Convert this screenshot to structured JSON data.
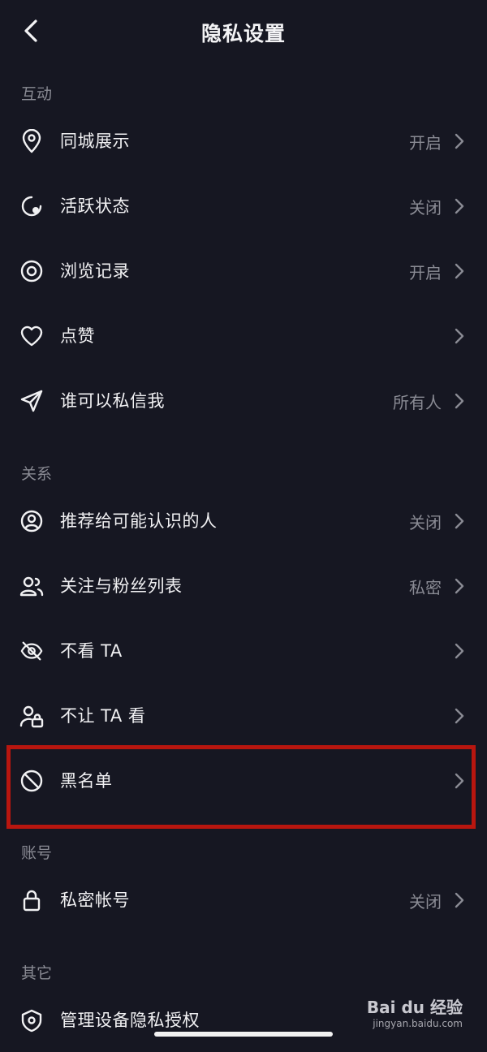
{
  "header": {
    "title": "隐私设置"
  },
  "sections": {
    "interaction": "互动",
    "relations": "关系",
    "account": "账号",
    "other": "其它"
  },
  "rows": {
    "local_display": {
      "label": "同城展示",
      "value": "开启"
    },
    "active_status": {
      "label": "活跃状态",
      "value": "关闭"
    },
    "browse_history": {
      "label": "浏览记录",
      "value": "开启"
    },
    "likes": {
      "label": "点赞",
      "value": ""
    },
    "who_can_dm": {
      "label": "谁可以私信我",
      "value": "所有人"
    },
    "recommend_to_known": {
      "label": "推荐给可能认识的人",
      "value": "关闭"
    },
    "follow_fans_list": {
      "label": "关注与粉丝列表",
      "value": "私密"
    },
    "dont_see": {
      "label": "不看 TA",
      "value": ""
    },
    "dont_let_see": {
      "label": "不让 TA 看",
      "value": ""
    },
    "blacklist": {
      "label": "黑名单",
      "value": ""
    },
    "private_account": {
      "label": "私密帐号",
      "value": "关闭"
    },
    "device_privacy": {
      "label": "管理设备隐私授权",
      "value": ""
    }
  },
  "watermark": {
    "brand": "Bai du 经验",
    "url": "jingyan.baidu.com"
  },
  "colors": {
    "background": "#161722",
    "highlight": "#b8160f",
    "secondary_text": "#8a8b94"
  }
}
